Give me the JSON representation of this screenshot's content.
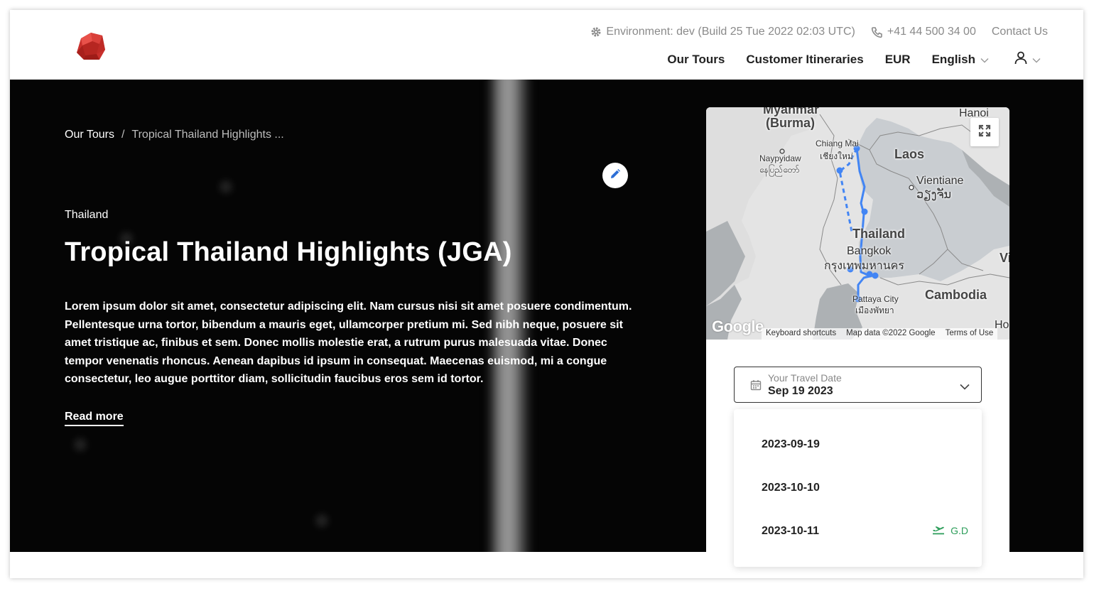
{
  "header": {
    "environment_label": "Environment: dev (Build 25 Tue 2022 02:03 UTC)",
    "phone": "+41 44 500 34 00",
    "contact": "Contact Us",
    "nav": {
      "tours": "Our Tours",
      "itineraries": "Customer Itineraries",
      "currency": "EUR",
      "language": "English"
    }
  },
  "breadcrumb": {
    "root": "Our Tours",
    "separator": "/",
    "current": "Tropical Thailand Highlights ..."
  },
  "tour": {
    "country": "Thailand",
    "title": "Tropical Thailand Highlights (JGA)",
    "description": "Lorem ipsum dolor sit amet, consectetur adipiscing elit. Nam cursus nisi sit amet posuere condimentum. Pellentesque urna tortor, bibendum a mauris eget, ullamcorper pretium mi. Sed nibh neque, posuere sit amet tristique ac, finibus et sem. Donec mollis molestie erat, a rutrum purus malesuada vitae. Donec tempor venenatis rhoncus. Aenean dapibus id ipsum in consequat. Maecenas euismod, mi a congue consectetur, leo augue porttitor diam, sollicitudin faucibus eros sem id tortor.",
    "read_more": "Read more"
  },
  "map": {
    "labels": {
      "myanmar": "Myanmar",
      "burma": "(Burma)",
      "hanoi": "Hanoi",
      "chiang_mai": "Chiang Mai",
      "chiang_mai_th": "เชียงใหม่",
      "naypyidaw": "Naypyidaw",
      "naypyidaw_my": "နေပြည်တော်",
      "laos": "Laos",
      "vientiane": "Vientiane",
      "vientiane_lo": "ວຽງຈັນ",
      "thailand": "Thailand",
      "bangkok": "Bangkok",
      "bangkok_th": "กรุงเทพมหานคร",
      "vi": "Vi",
      "cambodia": "Cambodia",
      "pattaya": "Pattaya City",
      "pattaya_th": "เมืองพัทยา",
      "ho": "Ho"
    },
    "google": "Google",
    "keyboard_shortcuts": "Keyboard shortcuts",
    "map_data": "Map data ©2022 Google",
    "terms": "Terms of Use",
    "route_color": "#4285f4"
  },
  "date_picker": {
    "label": "Your Travel Date",
    "value": "Sep 19 2023",
    "options": [
      {
        "date": "2023-09-19",
        "badge": ""
      },
      {
        "date": "2023-10-10",
        "badge": ""
      },
      {
        "date": "2023-10-11",
        "badge": "G.D"
      }
    ],
    "badge_color": "#2e9e5b"
  },
  "icons": {
    "logo": "ruby-gem-logo",
    "environment": "gear-icon",
    "phone": "phone-icon",
    "user": "user-icon",
    "edit": "pencil-icon",
    "fullscreen": "expand-icon",
    "calendar": "calendar-icon",
    "departure": "plane-departure-icon"
  }
}
